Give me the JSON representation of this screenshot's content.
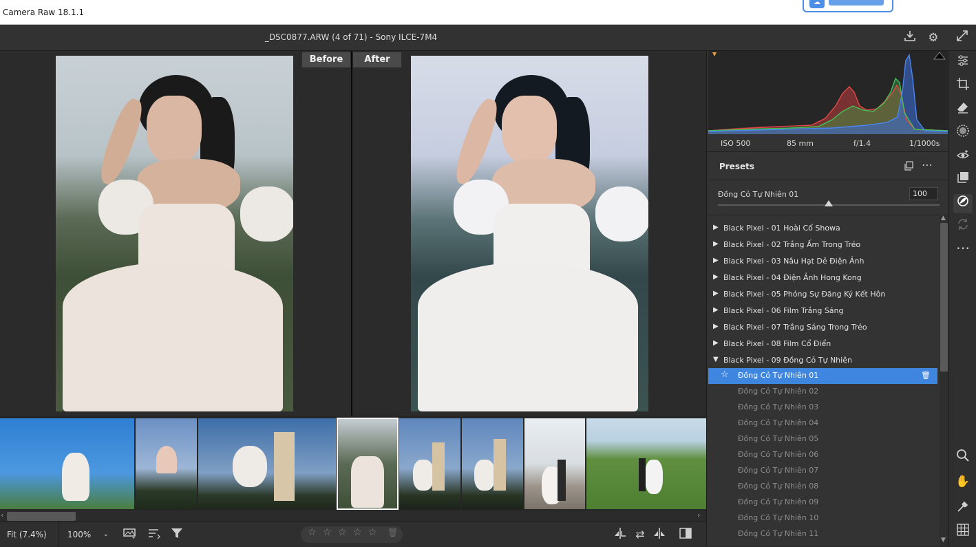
{
  "window": {
    "title": "Camera Raw 18.1.1"
  },
  "header": {
    "file_title": "_DSC0877.ARW  (4 of 71)  -  Sony ILCE-7M4",
    "icons": [
      "save-icon",
      "gear-icon",
      "fullscreen-icon"
    ]
  },
  "compare": {
    "before_label": "Before",
    "after_label": "After"
  },
  "exif": {
    "iso": "ISO 500",
    "focal": "85 mm",
    "aperture": "f/1.4",
    "shutter": "1/1000s"
  },
  "presets": {
    "title": "Presets",
    "amount_label": "Đồng Cỏ Tự Nhiên 01",
    "amount_value": "100",
    "amount_fraction": 0.5,
    "groups": [
      "Black Pixel - 01 Hoài Cổ Showa",
      "Black Pixel - 02 Trắng Ấm Trong Tréo",
      "Black Pixel - 03 Nâu Hạt Dẻ Điện Ảnh",
      "Black Pixel - 04 Điện Ảnh Hong Kong",
      "Black Pixel - 05 Phóng Sự Đăng Ký Kết Hôn",
      "Black Pixel - 06 Film Trắng Sáng",
      "Black Pixel - 07 Trắng Sáng Trong Tréo",
      "Black Pixel - 08 Film Cổ Điển",
      "Black Pixel - 09 Đồng Cỏ Tự Nhiên"
    ],
    "items": [
      "Đồng Cỏ Tự Nhiên 01",
      "Đồng Cỏ Tự Nhiên 02",
      "Đồng Cỏ Tự Nhiên 03",
      "Đồng Cỏ Tự Nhiên 04",
      "Đồng Cỏ Tự Nhiên 05",
      "Đồng Cỏ Tự Nhiên 06",
      "Đồng Cỏ Tự Nhiên 07",
      "Đồng Cỏ Tự Nhiên 08",
      "Đồng Cỏ Tự Nhiên 09",
      "Đồng Cỏ Tự Nhiên 10",
      "Đồng Cỏ Tự Nhiên 11"
    ],
    "active_index": 0
  },
  "bottom": {
    "zoom_fit": "Fit (7.4%)",
    "zoom_100": "100%"
  },
  "colors": {
    "accent": "#3f86e0",
    "panel": "#333333",
    "canvas": "#2b2b2b"
  },
  "tools": [
    "edit-sliders-icon",
    "crop-icon",
    "eraser-icon",
    "masking-icon",
    "redeye-icon",
    "snapshots-icon",
    "presets-icon",
    "sync-icon",
    "more-icon",
    "zoom-icon",
    "hand-icon",
    "color-sampler-icon",
    "grid-icon"
  ]
}
